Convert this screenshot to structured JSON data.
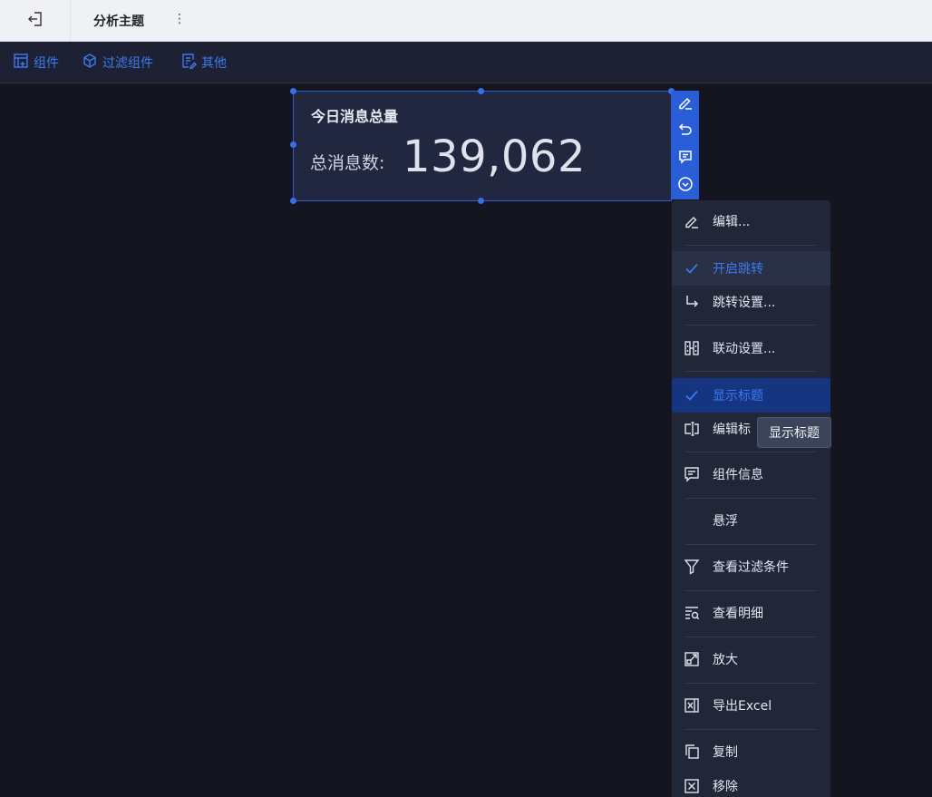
{
  "topbar": {
    "title": "分析主题",
    "more": "⋮"
  },
  "toolbar": {
    "items": [
      {
        "label": "组件",
        "icon": "chart-add-icon"
      },
      {
        "label": "过滤组件",
        "icon": "filter-cube-icon"
      },
      {
        "label": "其他",
        "icon": "doc-edit-icon"
      }
    ]
  },
  "widget": {
    "title": "今日消息总量",
    "label": "总消息数:",
    "value": "139,062"
  },
  "menu": {
    "items": [
      {
        "label": "编辑...",
        "icon": "edit-icon"
      },
      {
        "label": "开启跳转",
        "icon": "check-icon",
        "checked": true
      },
      {
        "label": "跳转设置...",
        "icon": "arrow-turn-icon"
      },
      {
        "label": "联动设置...",
        "icon": "link-grid-icon"
      },
      {
        "label": "显示标题",
        "icon": "check-icon",
        "checked": true
      },
      {
        "label": "编辑标",
        "icon": "title-edit-icon"
      },
      {
        "label": "组件信息",
        "icon": "info-message-icon"
      },
      {
        "label": "悬浮",
        "icon": ""
      },
      {
        "label": "查看过滤条件",
        "icon": "filter-icon"
      },
      {
        "label": "查看明细",
        "icon": "detail-search-icon"
      },
      {
        "label": "放大",
        "icon": "expand-icon"
      },
      {
        "label": "导出Excel",
        "icon": "excel-icon"
      },
      {
        "label": "复制",
        "icon": "copy-icon"
      },
      {
        "label": "移除",
        "icon": "remove-icon"
      }
    ]
  },
  "tooltip": "显示标题",
  "colors": {
    "accent": "#3a7af0",
    "selected_bg": "#153580",
    "widget_border": "#2f5bd8"
  }
}
